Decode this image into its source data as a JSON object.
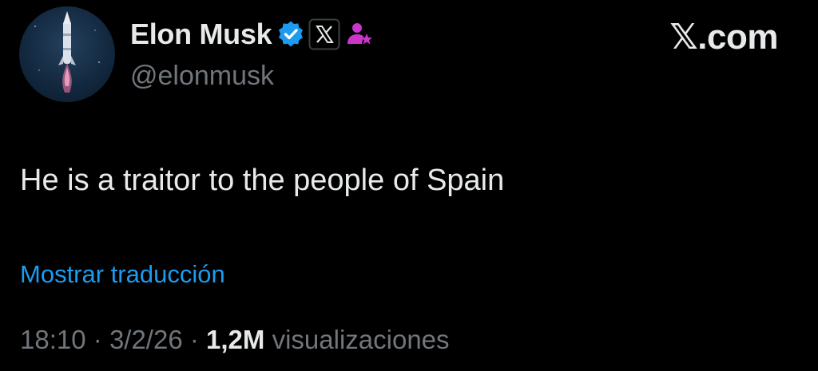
{
  "author": {
    "display_name": "Elon Musk",
    "handle": "@elonmusk",
    "verified_icon": "verified-badge-icon",
    "affiliate_icon": "x-logo-icon",
    "subscriber_icon": "subscriber-icon"
  },
  "brand": {
    "label": "𝕏.com"
  },
  "tweet": {
    "text": "He is a traitor to the people of Spain",
    "translate_label": "Mostrar traducción"
  },
  "meta": {
    "time": "18:10",
    "separator": "·",
    "date": "3/2/26",
    "views_count": "1,2M",
    "views_label": "visualizaciones"
  },
  "colors": {
    "background": "#000000",
    "text_primary": "#e7e9ea",
    "text_secondary": "#71767b",
    "link": "#1d9bf0",
    "verified": "#1d9bf0",
    "subscriber": "#c936c9"
  }
}
